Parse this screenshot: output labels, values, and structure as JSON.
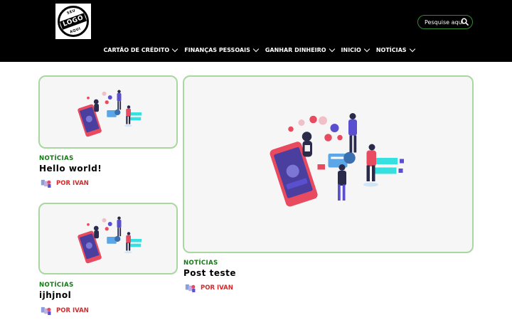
{
  "header": {
    "logo": {
      "top": "SEU",
      "main": "LOGO",
      "bottom": "AQUI"
    },
    "search": {
      "placeholder": "Pesquise aqui"
    },
    "nav": [
      {
        "label": "CARTÃO DE CRÉDITO"
      },
      {
        "label": "FINANÇAS PESSOAIS"
      },
      {
        "label": "GANHAR DINHEIRO"
      },
      {
        "label": "INICIO"
      },
      {
        "label": "NOTÍCIAS"
      }
    ]
  },
  "posts": [
    {
      "category": "NOTÍCIAS",
      "title": "Hello world!",
      "author": "POR IVAN"
    },
    {
      "category": "NOTÍCIAS",
      "title": "ijhjnol",
      "author": "POR IVAN"
    },
    {
      "category": "NOTÍCIAS",
      "title": "Post teste",
      "author": "POR IVAN"
    }
  ],
  "colors": {
    "header_bg": "#000000",
    "accent_green": "#117a11",
    "card_border": "#a8d8a0",
    "author_red": "#d22a2a"
  }
}
